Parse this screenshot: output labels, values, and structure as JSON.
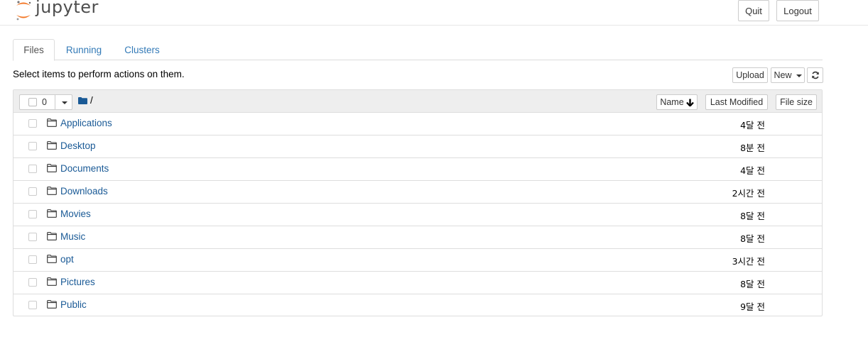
{
  "header": {
    "logo_text": "jupyter",
    "quit_label": "Quit",
    "logout_label": "Logout"
  },
  "tabs": [
    {
      "label": "Files",
      "active": true
    },
    {
      "label": "Running",
      "active": false
    },
    {
      "label": "Clusters",
      "active": false
    }
  ],
  "toolbar": {
    "instructions": "Select items to perform actions on them.",
    "upload_label": "Upload",
    "new_label": "New"
  },
  "list_header": {
    "selected_count": "0",
    "breadcrumb_path": "/",
    "sort_name_label": "Name",
    "sort_modified_label": "Last Modified",
    "sort_size_label": "File size"
  },
  "files": [
    {
      "name": "Applications",
      "modified": "4달 전",
      "type": "folder"
    },
    {
      "name": "Desktop",
      "modified": "8분 전",
      "type": "folder"
    },
    {
      "name": "Documents",
      "modified": "4달 전",
      "type": "folder"
    },
    {
      "name": "Downloads",
      "modified": "2시간 전",
      "type": "folder"
    },
    {
      "name": "Movies",
      "modified": "8달 전",
      "type": "folder"
    },
    {
      "name": "Music",
      "modified": "8달 전",
      "type": "folder"
    },
    {
      "name": "opt",
      "modified": "3시간 전",
      "type": "folder"
    },
    {
      "name": "Pictures",
      "modified": "8달 전",
      "type": "folder"
    },
    {
      "name": "Public",
      "modified": "9달 전",
      "type": "folder"
    }
  ],
  "colors": {
    "link": "#1a5a96",
    "tab_link": "#337ab7",
    "logo_orange": "#f37726",
    "panel_header_bg": "#eeeeee",
    "border": "#dddddd"
  },
  "icons": {
    "logo": "jupyter-logo-icon",
    "folder": "folder-outline-icon",
    "breadcrumb_folder": "folder-solid-icon",
    "sort_arrow": "arrow-down-icon",
    "refresh": "refresh-icon",
    "dropdown": "caret-down-icon"
  }
}
